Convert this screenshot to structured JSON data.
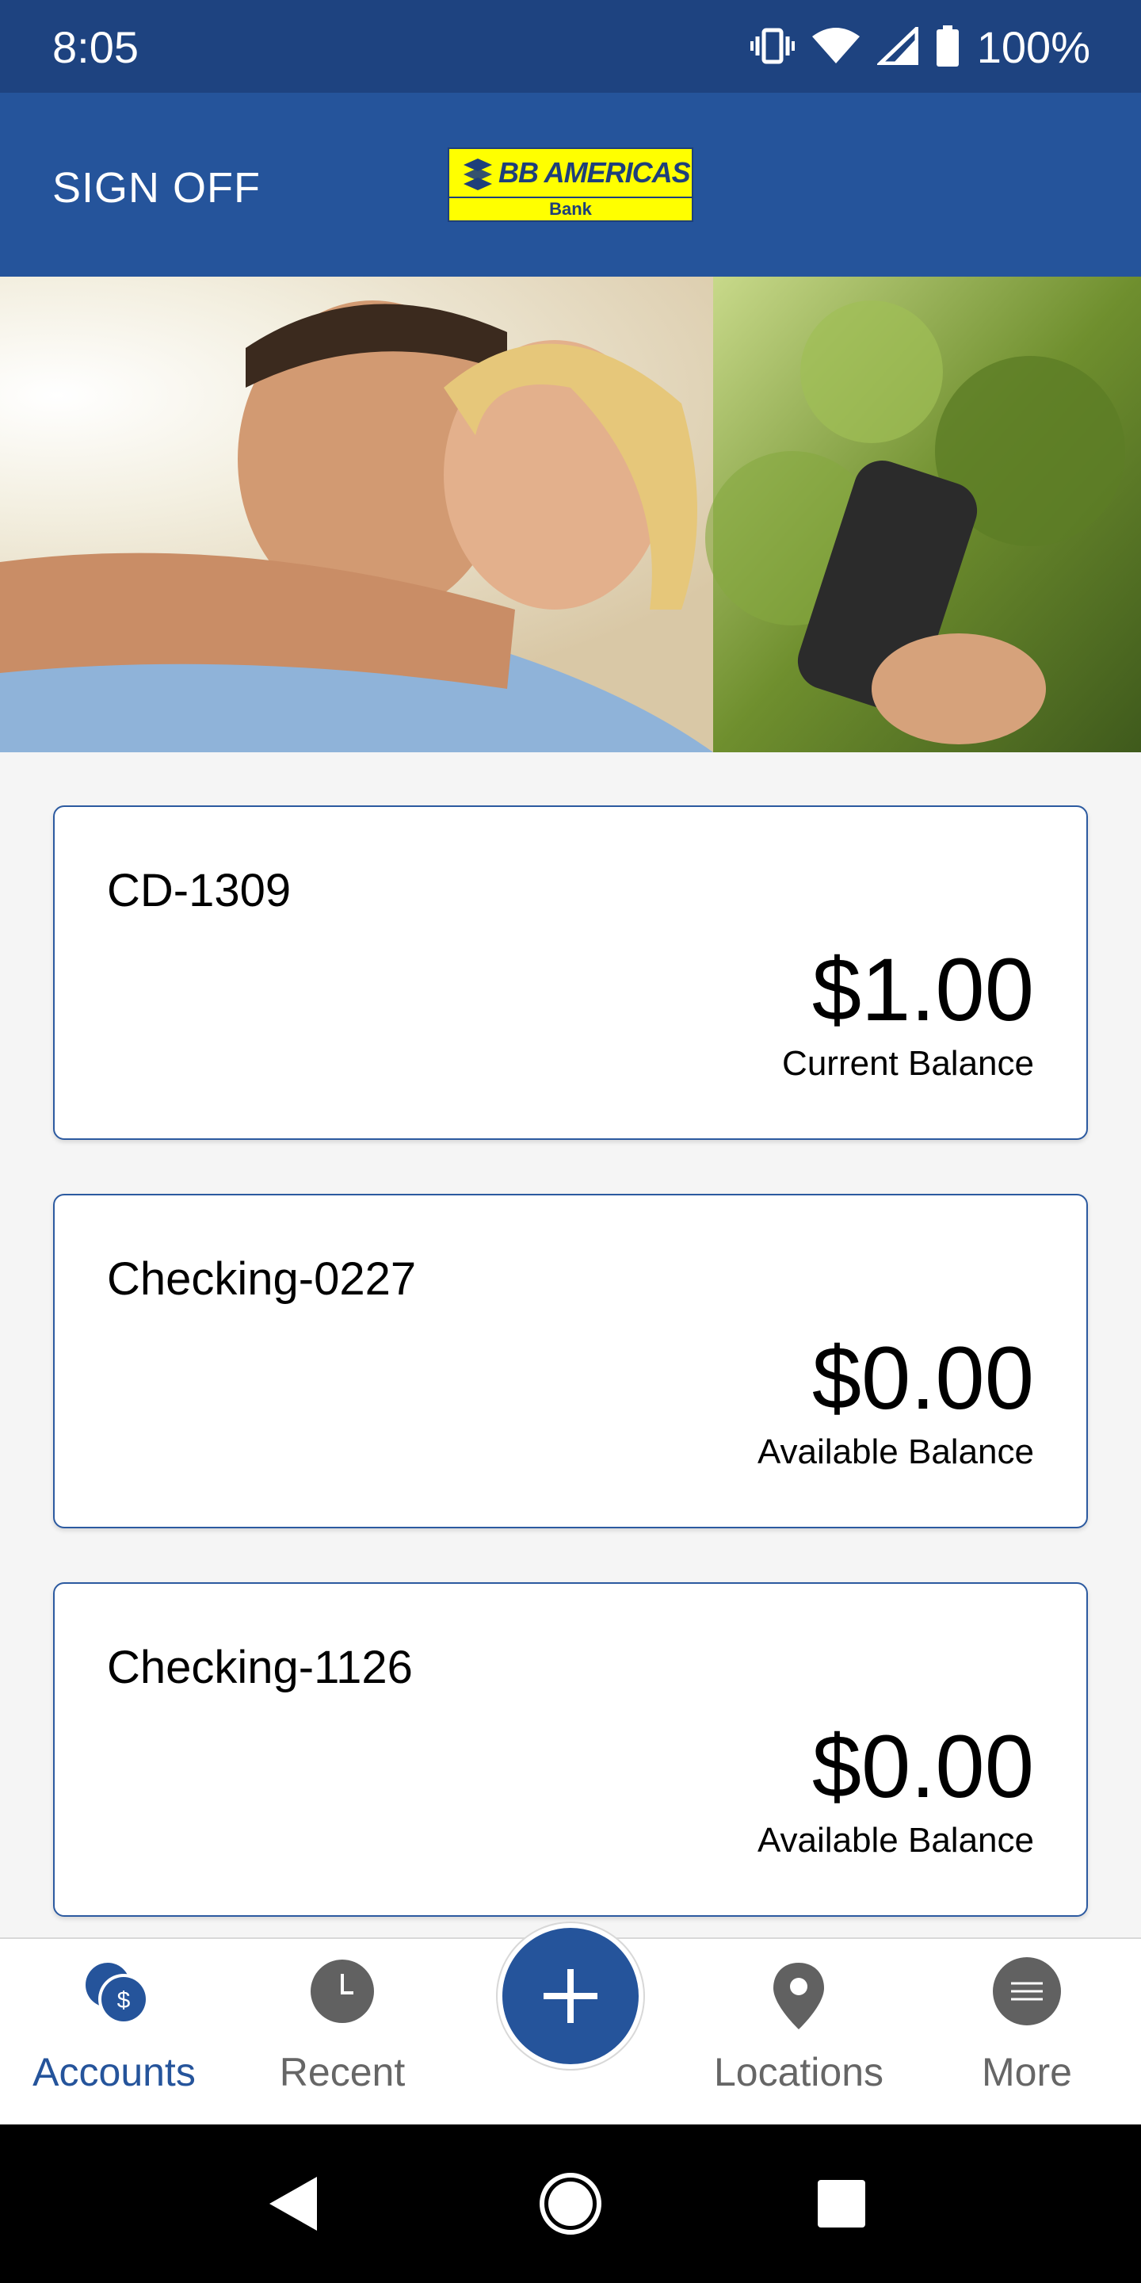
{
  "status_bar": {
    "time": "8:05",
    "battery": "100%",
    "icons": [
      "vibrate-icon",
      "wifi-icon",
      "signal-icon",
      "battery-icon"
    ]
  },
  "header": {
    "sign_off_label": "SIGN OFF",
    "logo_text": "BB AMERICAS",
    "logo_subtext": "Bank"
  },
  "hero": {
    "description_icon": "hero-photo"
  },
  "accounts": [
    {
      "name": "CD-1309",
      "amount": "$1.00",
      "balance_label": "Current Balance"
    },
    {
      "name": "Checking-0227",
      "amount": "$0.00",
      "balance_label": "Available Balance"
    },
    {
      "name": "Checking-1126",
      "amount": "$0.00",
      "balance_label": "Available Balance"
    }
  ],
  "bottom_nav": {
    "items": [
      {
        "label": "Accounts",
        "icon": "accounts-icon",
        "active": true
      },
      {
        "label": "Recent",
        "icon": "clock-icon",
        "active": false
      },
      {
        "label": "Locations",
        "icon": "location-pin-icon",
        "active": false
      },
      {
        "label": "More",
        "icon": "menu-icon",
        "active": false
      }
    ],
    "fab_icon": "plus-icon"
  },
  "colors": {
    "status_bar": "#1e4380",
    "header": "#25549b",
    "accent": "#25549b",
    "logo_yellow": "#ffff00"
  }
}
